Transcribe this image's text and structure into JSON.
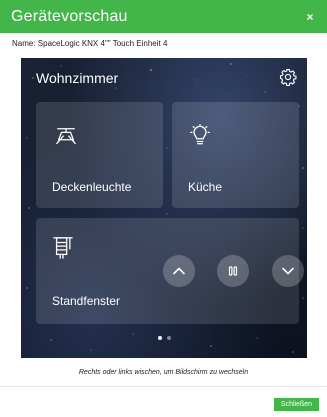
{
  "dialog": {
    "title": "Gerätevorschau",
    "close_glyph": "×",
    "device_name": "Name: SpaceLogic KNX 4\"\" Touch Einheit 4",
    "hint": "Rechts oder links wischen, um Bildschirm zu wechseln",
    "close_button_label": "Schließen",
    "accent_color": "#42b649"
  },
  "screen": {
    "room_name": "Wohnzimmer",
    "settings_icon": "gear-icon",
    "tiles": [
      {
        "label": "Deckenleuchte",
        "icon": "ceiling-lamp-icon"
      },
      {
        "label": "Küche",
        "icon": "light-bulb-icon"
      },
      {
        "label": "Standfenster",
        "icon": "blind-icon"
      }
    ],
    "blind_controls": [
      "chevron-up-icon",
      "pause-icon",
      "chevron-down-icon"
    ],
    "pages": {
      "count": 2,
      "active": 1
    }
  }
}
